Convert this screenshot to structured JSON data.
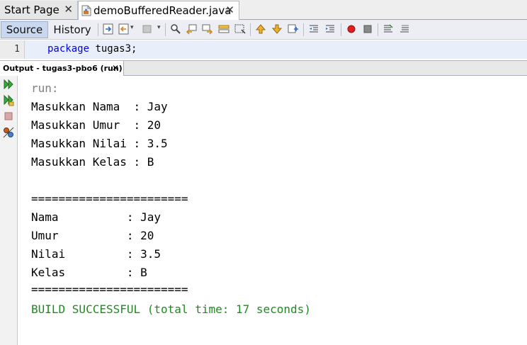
{
  "editor_tabs": [
    {
      "label": "Start Page",
      "close": "✕"
    },
    {
      "label": "demoBufferedReader.java",
      "close": "✕"
    }
  ],
  "toolbar": {
    "source_label": "Source",
    "history_label": "History"
  },
  "editor": {
    "line_number": "1",
    "keyword": "package",
    "code_rest": " tugas3;"
  },
  "output_tab": {
    "label": "Output - tugas3-pbo6 (run)",
    "close": "✕"
  },
  "output": {
    "lines": [
      "run:",
      "Masukkan Nama  : Jay",
      "Masukkan Umur  : 20",
      "Masukkan Nilai : 3.5",
      "Masukkan Kelas : B",
      "",
      "=======================",
      "Nama          : Jay",
      "Umur          : 20",
      "Nilai         : 3.5",
      "Kelas         : B",
      "=======================",
      "BUILD SUCCESSFUL (total time: 17 seconds)"
    ]
  },
  "icons": {
    "rerun": "rerun-icon",
    "rerun_with_params": "rerun-with-params-icon",
    "stop": "stop-icon",
    "settings": "settings-icon"
  },
  "colors": {
    "build_success": "#1f8a1f",
    "run_text": "#808080",
    "keyword": "#0000e6",
    "current_line": "#e9effa"
  }
}
